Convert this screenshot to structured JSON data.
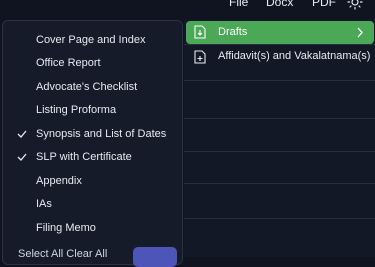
{
  "topbar": {
    "file": "File",
    "docx": "Docx",
    "pdf": "PDF"
  },
  "menu": {
    "items": [
      {
        "label": "Cover Page and Index",
        "checked": false
      },
      {
        "label": "Office Report",
        "checked": false
      },
      {
        "label": "Advocate's Checklist",
        "checked": false
      },
      {
        "label": "Listing Proforma",
        "checked": false
      },
      {
        "label": "Synopsis and List of Dates",
        "checked": true
      },
      {
        "label": "SLP with Certificate",
        "checked": true
      },
      {
        "label": "Appendix",
        "checked": false
      },
      {
        "label": "IAs",
        "checked": false
      },
      {
        "label": "Filing Memo",
        "checked": false
      }
    ]
  },
  "bottom": {
    "text": "Select All   Clear All"
  },
  "submenu": {
    "drafts_label": "Drafts",
    "affidavit_label": "Affidavit(s) and Vakalatnama(s)"
  },
  "colors": {
    "accent_green": "#4aa856",
    "accent_blue": "#4d55b8"
  }
}
